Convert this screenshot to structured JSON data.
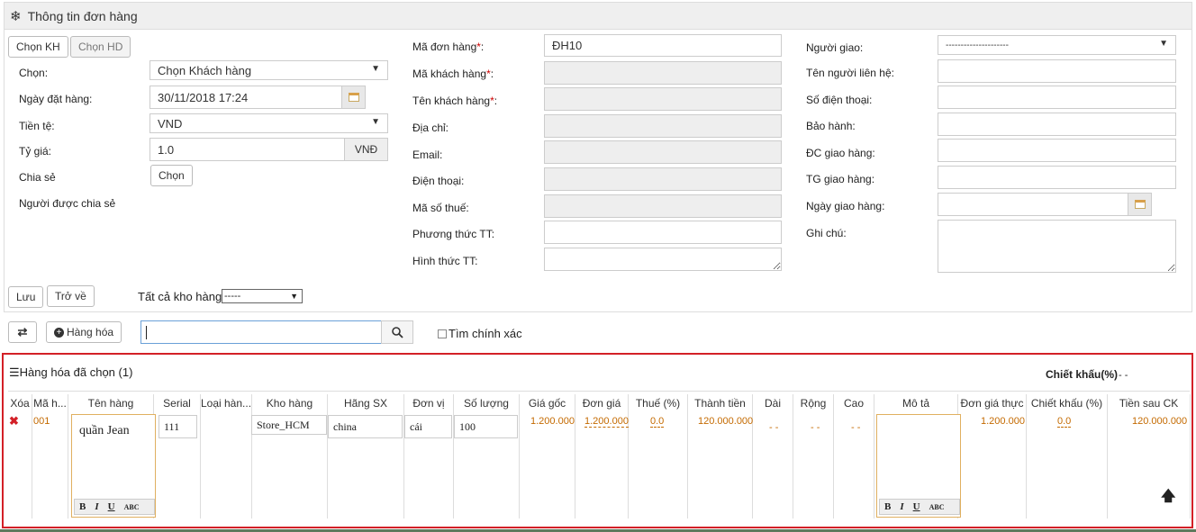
{
  "panel": {
    "title": "Thông tin đơn hàng",
    "icon": "snowflake-icon"
  },
  "left": {
    "btn_chon_kh": "Chọn KH",
    "btn_chon_hd": "Chọn HD",
    "chon_label": "Chọn:",
    "chon_value": "Chọn Khách hàng",
    "ngay_label": "Ngày đặt hàng:",
    "ngay_value": "30/11/2018 17:24",
    "tiente_label": "Tiền tệ:",
    "tiente_value": "VND",
    "tygia_label": "Tỷ giá:",
    "tygia_value": "1.0",
    "tygia_unit": "VNĐ",
    "chiase_label": "Chia sẻ",
    "chiase_btn": "Chọn",
    "nguoi_label": "Người được chia sẻ"
  },
  "middle": {
    "madon_label": "Mã đơn hàng",
    "madon_value": "ĐH10",
    "makh_label": "Mã khách hàng",
    "tenkh_label": "Tên khách hàng",
    "diachi_label": "Địa chỉ:",
    "email_label": "Email:",
    "dienthoai_label": "Điện thoại:",
    "masothue_label": "Mã số thuế:",
    "phuongthuc_label": "Phương thức TT:",
    "hinhthuc_label": "Hình thức TT:",
    "star": "*",
    "colon": ":"
  },
  "right": {
    "nguoigiao_label": "Người giao:",
    "nguoigiao_value": "---------------------",
    "tenlh_label": "Tên người liên hệ:",
    "sdt_label": "Số điện thoại:",
    "baohanh_label": "Bảo hành:",
    "dcgiao_label": "ĐC giao hàng:",
    "tggiao_label": "TG giao hàng:",
    "ngaygiao_label": "Ngày giao hàng:",
    "ghichu_label": "Ghi chú:"
  },
  "footer": {
    "luu": "Lưu",
    "trove": "Trở về",
    "kho_label": "Tất cả kho hàng",
    "kho_value": "-----"
  },
  "toolbar": {
    "hanghoa": "Hàng hóa",
    "timchinhxac": "Tìm chính xác"
  },
  "selected": {
    "title": "Hàng hóa đã chọn (1)",
    "chietkhau_label": "Chiết khấu(%)",
    "chietkhau_value": "- -",
    "headers": [
      "Xóa",
      "Mã h...",
      "Tên hàng",
      "Serial",
      "Loại hàn...",
      "Kho hàng",
      "Hãng SX",
      "Đơn vị",
      "Số lượng",
      "Giá gốc",
      "Đơn giá",
      "Thuế (%)",
      "Thành tiền",
      "Dài",
      "Rộng",
      "Cao",
      "Mô tả",
      "Đơn giá thực",
      "Chiết khấu (%)",
      "Tiền sau CK"
    ],
    "row": {
      "ma": "001",
      "ten": "quần Jean",
      "serial": "111",
      "kho": "Store_HCM",
      "hang": "china",
      "donvi": "cái",
      "soluong": "100",
      "giagoc": "1.200.000",
      "dongia": "1.200.000",
      "thue": "0.0",
      "thanhtien": "120.000.000",
      "dai": "- -",
      "rong": "- -",
      "cao": "- -",
      "dongiathuc": "1.200.000",
      "chietkhau": "0.0",
      "tiensauck": "120.000.000"
    },
    "editor": {
      "b": "B",
      "i": "I",
      "u": "U",
      "abc": "ABC"
    }
  }
}
